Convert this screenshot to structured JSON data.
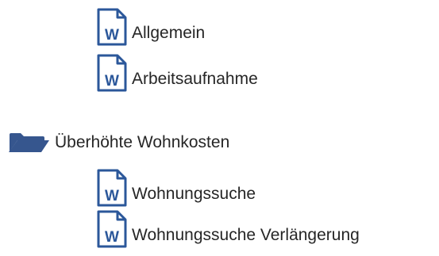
{
  "tree": {
    "group1": {
      "items": [
        {
          "label": "Allgemein",
          "icon": "word-document-icon"
        },
        {
          "label": "Arbeitsaufnahme",
          "icon": "word-document-icon"
        }
      ]
    },
    "folder": {
      "label": "Überhöhte Wohnkosten",
      "icon": "folder-open-icon",
      "items": [
        {
          "label": "Wohnungssuche",
          "icon": "word-document-icon"
        },
        {
          "label": "Wohnungssuche Verlängerung",
          "icon": "word-document-icon"
        }
      ]
    }
  },
  "colors": {
    "icon_blue": "#2b579a",
    "folder_blue": "#36568e",
    "text": "#262626"
  }
}
